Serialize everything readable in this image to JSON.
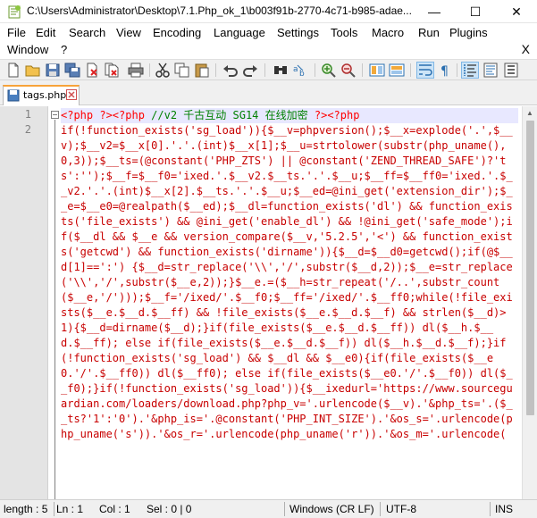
{
  "window": {
    "title": "C:\\Users\\Administrator\\Desktop\\7.1.Php_ok_1\\b003f91b-2770-4c71-b985-adae...",
    "minimize": "—",
    "maximize": "☐",
    "close": "✕"
  },
  "menu": {
    "items": [
      "File",
      "Edit",
      "Search",
      "View",
      "Encoding",
      "Language",
      "Settings",
      "Tools",
      "Macro",
      "Run",
      "Plugins",
      "Window",
      "?"
    ],
    "close_doc": "X"
  },
  "toolbar": {
    "icons": [
      "new-file-icon",
      "open-file-icon",
      "save-icon",
      "save-all-icon",
      "close-icon",
      "close-all-icon",
      "print-icon",
      "cut-icon",
      "copy-icon",
      "paste-icon",
      "undo-icon",
      "redo-icon",
      "find-icon",
      "replace-icon",
      "zoom-in-icon",
      "zoom-out-icon",
      "sync-vertical-icon",
      "sync-horizontal-icon",
      "word-wrap-icon",
      "show-all-chars-icon",
      "indent-guide-icon"
    ]
  },
  "tab": {
    "label": "tags.php",
    "accent": "#f7a33a"
  },
  "editor": {
    "line_numbers": [
      "1",
      "2"
    ],
    "line1": {
      "code": "<?php ?><?php ",
      "comment": "//v2 千古互动 SG14 在线加密",
      "tail": " ?><?php"
    },
    "line2": "if(!function_exists('sg_load')){$__v=phpversion();$__x=explode('.',$__v);$__v2=$__x[0].'.'.(int)$__x[1];$__u=strtolower(substr(php_uname(),0,3));$__ts=(@constant('PHP_ZTS') || @constant('ZEND_THREAD_SAFE')?'ts':'');$__f=$__f0='ixed.'.$__v2.$__ts.'.'.$__u;$__ff=$__ff0='ixed.'.$__v2.'.'.(int)$__x[2].$__ts.'.'.$__u;$__ed=@ini_get('extension_dir');$__e=$__e0=@realpath($__ed);$__dl=function_exists('dl') && function_exists('file_exists') && @ini_get('enable_dl') && !@ini_get('safe_mode');if($__dl && $__e && version_compare($__v,'5.2.5','<') && function_exists('getcwd') && function_exists('dirname')){$__d=$__d0=getcwd();if(@$__d[1]==':') {$__d=str_replace('\\\\','/',substr($__d,2));$__e=str_replace('\\\\','/',substr($__e,2));}$__e.=($__h=str_repeat('/..',substr_count($__e,'/')));$__f='/ixed/'.$__f0;$__ff='/ixed/'.$__ff0;while(!file_exists($__e.$__d.$__ff) && !file_exists($__e.$__d.$__f) && strlen($__d)>1){$__d=dirname($__d);}if(file_exists($__e.$__d.$__ff)) dl($__h.$__d.$__ff); else if(file_exists($__e.$__d.$__f)) dl($__h.$__d.$__f);}if(!function_exists('sg_load') && $__dl && $__e0){if(file_exists($__e0.'/'.$__ff0)) dl($__ff0); else if(file_exists($__e0.'/'.$__f0)) dl($__f0);}if(!function_exists('sg_load')){$__ixedurl='https://www.sourceguardian.com/loaders/download.php?php_v='.urlencode($__v).'&php_ts='.($__ts?'1':'0').'&php_is='.@constant('PHP_INT_SIZE').'&os_s='.urlencode(php_uname('s')).'&os_r='.urlencode(php_uname('r')).'&os_m='.urlencode("
  },
  "status": {
    "length": "length : 5",
    "line": "Ln : 1",
    "col": "Col : 1",
    "sel": "Sel : 0 | 0",
    "eol": "Windows (CR LF)",
    "encoding": "UTF-8",
    "mode": "INS"
  }
}
